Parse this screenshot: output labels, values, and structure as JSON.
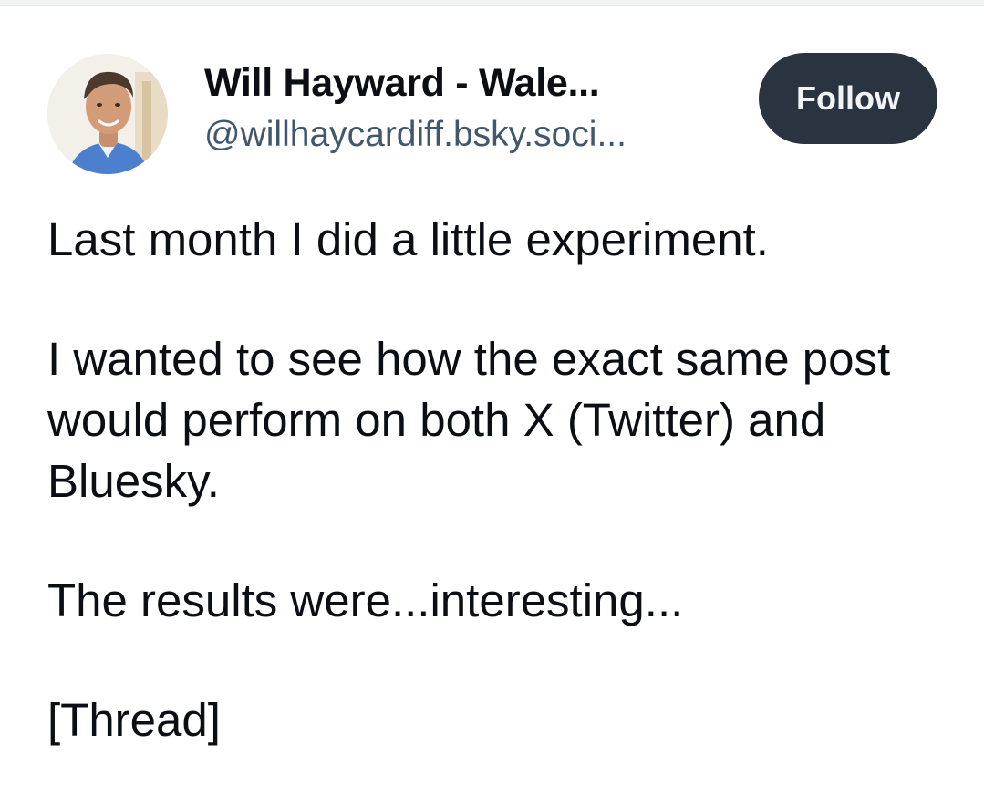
{
  "post": {
    "author": {
      "display_name": "Will Hayward - Wale...",
      "handle": "@willhaycardiff.bsky.soci..."
    },
    "follow_label": "Follow",
    "paragraphs": [
      "Last month I did a little experiment.",
      "I wanted to see how the exact same post would perform on both X (Twitter) and Bluesky.",
      "The results were...interesting...",
      "[Thread]"
    ]
  },
  "colors": {
    "follow_button_bg": "#2a3441",
    "follow_button_text": "#f1f3f5",
    "handle_text": "#42576c",
    "body_text": "#0b0f14"
  }
}
